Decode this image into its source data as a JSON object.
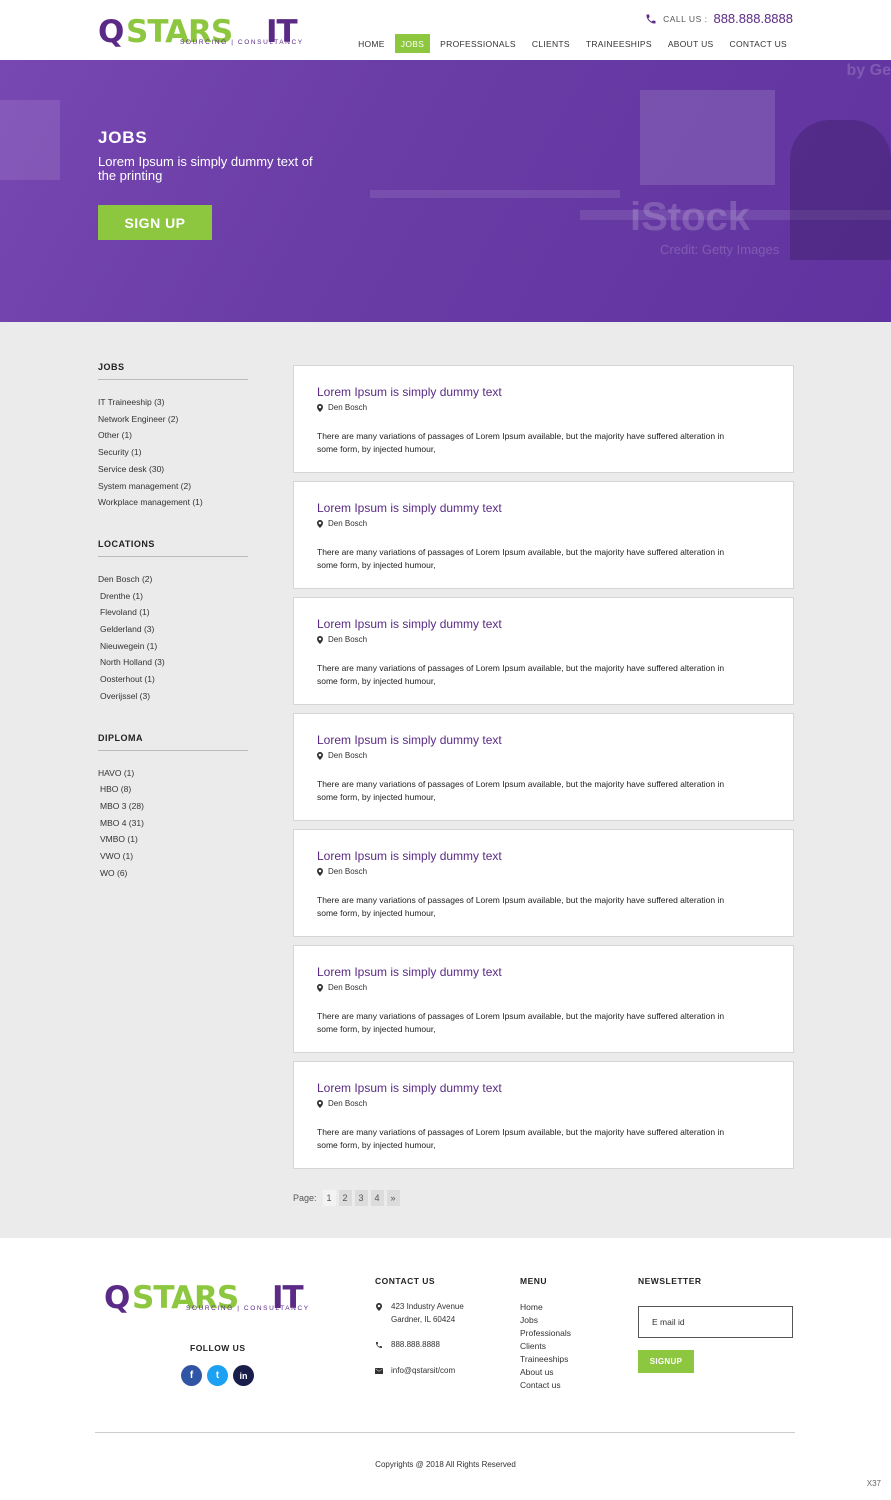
{
  "brand": {
    "logo_q": "Q",
    "logo_stars": "STARS",
    "logo_it": "IT",
    "tagline": "SOURCING | CONSULTANCY",
    "colors": {
      "purple": "#5b2a86",
      "green": "#8dc63f"
    }
  },
  "header": {
    "call_label": "CALL US :",
    "call_number": "888.888.8888",
    "call_icon": "phone-icon",
    "nav": [
      "HOME",
      "JOBS",
      "PROFESSIONALS",
      "CLIENTS",
      "TRAINEESHIPS",
      "ABOUT US",
      "CONTACT US"
    ],
    "active_nav": "JOBS"
  },
  "hero": {
    "title": "JOBS",
    "subtitle": "Lorem Ipsum is simply dummy text of the printing",
    "signup_label": "SIGN UP",
    "watermark_1": "by Ge",
    "watermark_2": "iStock",
    "watermark_3": "Credit: Getty Images"
  },
  "sidebar": {
    "jobs": {
      "title": "JOBS",
      "items": [
        "IT Traineeship (3)",
        "Network Engineer (2)",
        "Other (1)",
        "Security (1)",
        "Service desk (30)",
        "System management (2)",
        "Workplace management (1)"
      ]
    },
    "locations": {
      "title": "LOCATIONS",
      "items": [
        "Den Bosch (2)",
        "Drenthe (1)",
        "Flevoland (1)",
        "Gelderland (3)",
        "Nieuwegein (1)",
        "North Holland (3)",
        "Oosterhout (1)",
        "Overijssel (3)"
      ]
    },
    "diploma": {
      "title": "DIPLOMA",
      "items": [
        "HAVO (1)",
        "HBO (8)",
        "MBO 3 (28)",
        "MBO 4 (31)",
        "VMBO (1)",
        "VWO (1)",
        "WO (6)"
      ]
    }
  },
  "jobs": [
    {
      "title": "Lorem Ipsum is simply dummy text",
      "location": "Den Bosch",
      "text": "There are many variations of passages of Lorem Ipsum available, but the majority have suffered alteration in some form, by injected humour,"
    },
    {
      "title": "Lorem Ipsum is simply dummy text",
      "location": "Den Bosch",
      "text": "There are many variations of passages of Lorem Ipsum available, but the majority have suffered alteration in some form, by injected humour,"
    },
    {
      "title": "Lorem Ipsum is simply dummy text",
      "location": "Den Bosch",
      "text": "There are many variations of passages of Lorem Ipsum available, but the majority have suffered alteration in some form, by injected humour,"
    },
    {
      "title": "Lorem Ipsum is simply dummy text",
      "location": "Den Bosch",
      "text": "There are many variations of passages of Lorem Ipsum available, but the majority have suffered alteration in some form, by injected humour,"
    },
    {
      "title": "Lorem Ipsum is simply dummy text",
      "location": "Den Bosch",
      "text": "There are many variations of passages of Lorem Ipsum available, but the majority have suffered alteration in some form, by injected humour,"
    },
    {
      "title": "Lorem Ipsum is simply dummy text",
      "location": "Den Bosch",
      "text": "There are many variations of passages of Lorem Ipsum available, but the majority have suffered alteration in some form, by injected humour,"
    },
    {
      "title": "Lorem Ipsum is simply dummy text",
      "location": "Den Bosch",
      "text": "There are many variations of passages of Lorem Ipsum available, but the majority have suffered alteration in some form, by injected humour,"
    }
  ],
  "pagination": {
    "label": "Page:",
    "pages": [
      "1",
      "2",
      "3",
      "4",
      "»"
    ],
    "current": "1"
  },
  "footer": {
    "follow_label": "FOLLOW US",
    "socials": [
      {
        "name": "facebook-icon",
        "glyph": "f",
        "color": "#2f55a4"
      },
      {
        "name": "twitter-icon",
        "glyph": "t",
        "color": "#1da1f2"
      },
      {
        "name": "linkedin-icon",
        "glyph": "in",
        "color": "#1a1e4a"
      }
    ],
    "contact_title": "CONTACT US",
    "address_line1": "423 Industry Avenue",
    "address_line2": "Gardner, IL 60424",
    "phone": "888.888.8888",
    "email": "info@qstarsit/com",
    "menu_title": "MENU",
    "menu": [
      "Home",
      "Jobs",
      "Professionals",
      "Clients",
      "Traineeships",
      "About us",
      "Contact us"
    ],
    "newsletter_title": "NEWSLETTER",
    "email_placeholder": "E mail id",
    "signup_label": "SIGNUP",
    "copyright": "Copyrights @ 2018 All Rights Reserved",
    "corner_code": "X37"
  }
}
